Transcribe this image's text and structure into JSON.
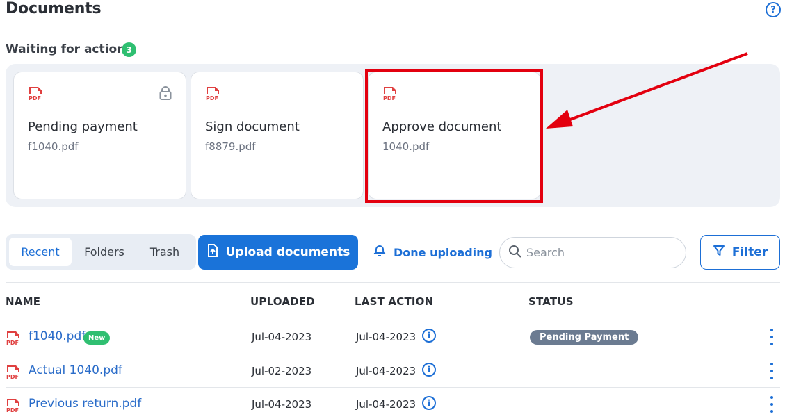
{
  "header": {
    "title": "Documents",
    "help_icon": "question-circle-icon",
    "help_label": "?"
  },
  "waiting": {
    "title": "Waiting for action",
    "count": "3",
    "cards": [
      {
        "title": "Pending payment",
        "file": "f1040.pdf",
        "locked": true
      },
      {
        "title": "Sign document",
        "file": "f8879.pdf",
        "locked": false
      },
      {
        "title": "Approve document",
        "file": "1040.pdf",
        "locked": false,
        "highlighted": true
      }
    ]
  },
  "toolbar": {
    "tabs": [
      {
        "label": "Recent",
        "active": true
      },
      {
        "label": "Folders",
        "active": false
      },
      {
        "label": "Trash",
        "active": false
      }
    ],
    "upload_label": "Upload documents",
    "done_label": "Done uploading",
    "search_placeholder": "Search",
    "filter_label": "Filter"
  },
  "table": {
    "columns": [
      "NAME",
      "UPLOADED",
      "LAST ACTION",
      "STATUS"
    ],
    "rows": [
      {
        "name": "f1040.pdf",
        "badge": "New",
        "uploaded": "Jul-04-2023",
        "last_action": "Jul-04-2023",
        "status": "Pending Payment"
      },
      {
        "name": "Actual 1040.pdf",
        "badge": "",
        "uploaded": "Jul-02-2023",
        "last_action": "Jul-04-2023",
        "status": ""
      },
      {
        "name": "Previous return.pdf",
        "badge": "",
        "uploaded": "Jul-04-2023",
        "last_action": "Jul-04-2023",
        "status": ""
      }
    ]
  },
  "colors": {
    "accent": "#1d6fd6",
    "primary_button": "#1a73d9",
    "success": "#2fbf71",
    "pdf_red": "#e04040",
    "annotation_red": "#e3000f",
    "status_gray": "#6b7b91"
  }
}
